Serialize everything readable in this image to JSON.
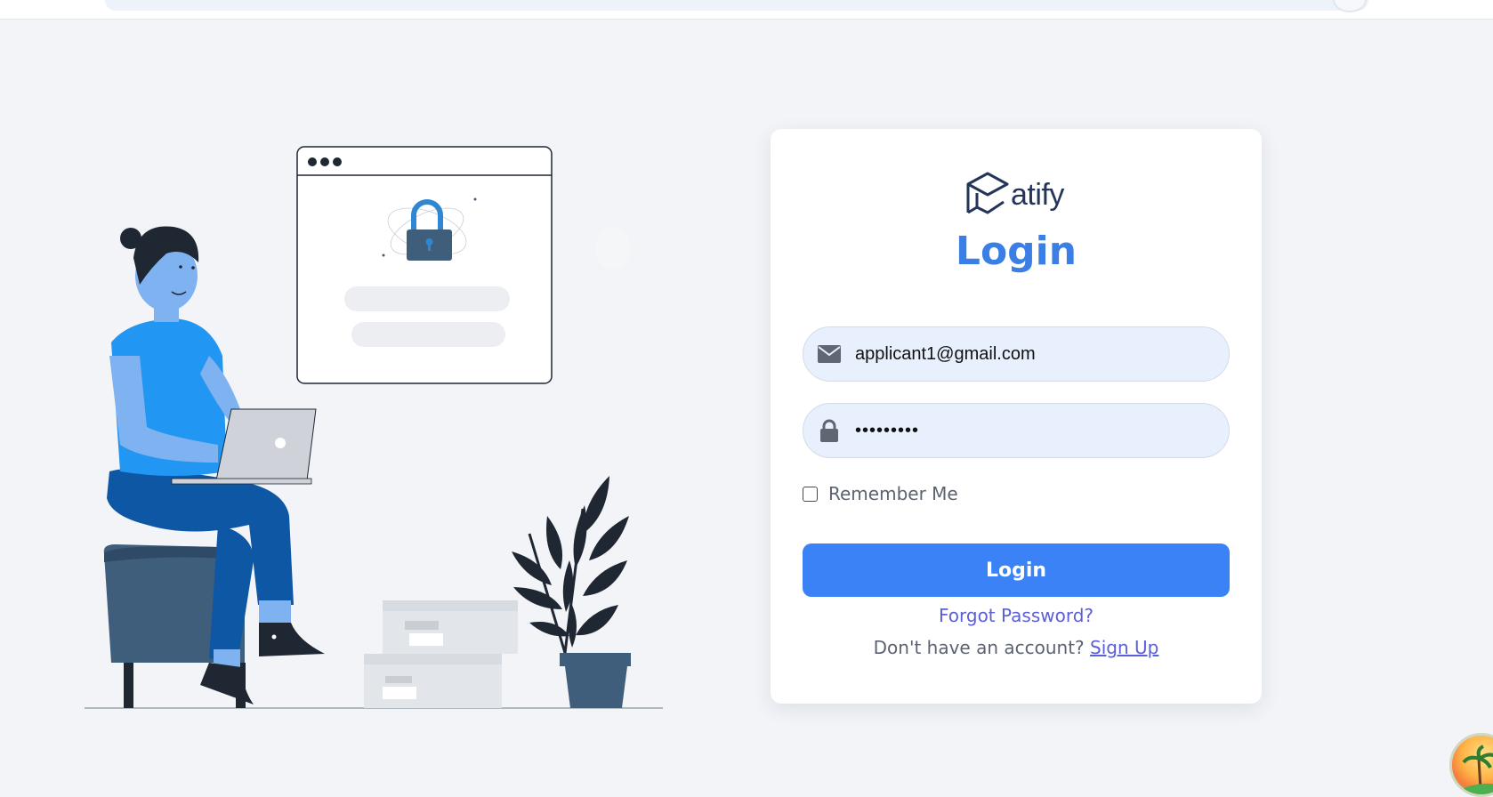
{
  "login_form": {
    "logo_text": "atify",
    "title": "Login",
    "email": {
      "value": "applicant1@gmail.com",
      "icon": "envelope-icon"
    },
    "password": {
      "masked_value": "•••••••••",
      "icon": "lock-icon"
    },
    "remember_me_label": "Remember Me",
    "remember_me_checked": false,
    "login_button_label": "Login",
    "forgot_password_link": "Forgot Password?",
    "signup_prompt": "Don't have an account?",
    "signup_link": "Sign Up"
  },
  "colors": {
    "page_background": "#f2f4f7",
    "accent_blue": "#3b82f6",
    "title_blue": "#3b7fe6",
    "link_purple": "#5a5fd8",
    "input_background": "#e8f0fe",
    "logo_navy": "#25355a"
  },
  "illustration": {
    "subject": "person-with-laptop-and-login-window-illustration",
    "icons": [
      "lock-icon",
      "laptop-icon",
      "plant-icon",
      "storage-box-icon"
    ]
  }
}
